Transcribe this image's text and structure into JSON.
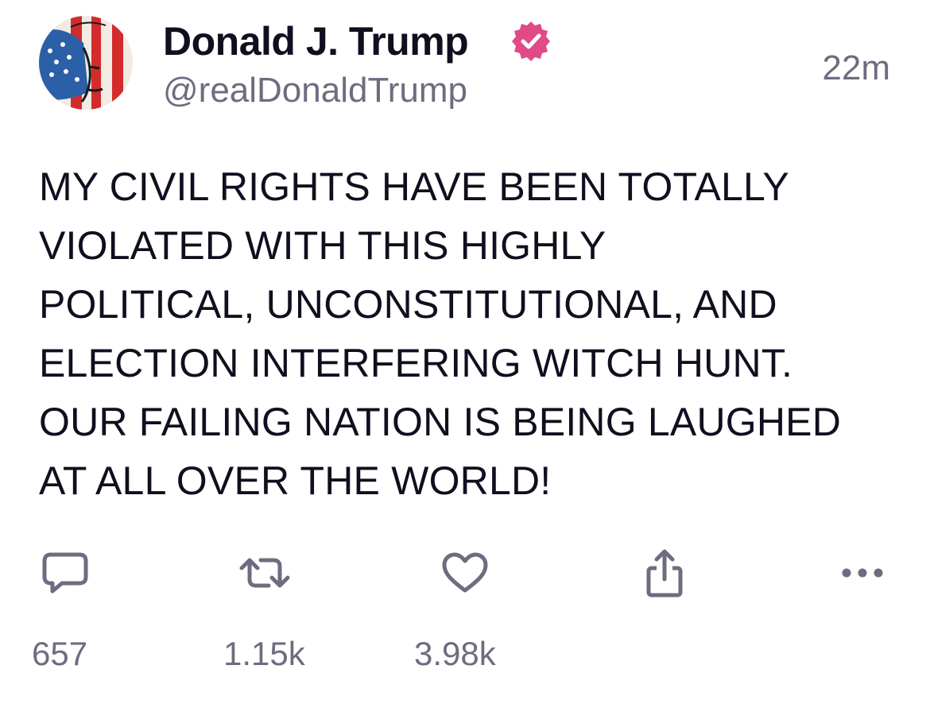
{
  "post": {
    "author": {
      "display_name": "Donald J. Trump",
      "handle": "@realDonaldTrump",
      "verified": true,
      "avatar_icon": "flag-painted-portrait-avatar"
    },
    "timestamp": "22m",
    "body_lines": [
      "MY CIVIL RIGHTS HAVE BEEN TOTALLY",
      "VIOLATED WITH THIS HIGHLY",
      "POLITICAL, UNCONSTITUTIONAL, AND",
      "ELECTION INTERFERING WITCH HUNT.",
      "OUR FAILING NATION IS BEING LAUGHED",
      "AT ALL OVER THE WORLD!"
    ],
    "actions": {
      "reply": {
        "icon": "reply-bubble-icon",
        "count": "657"
      },
      "retruth": {
        "icon": "retruth-arrows-icon",
        "count": "1.15k"
      },
      "like": {
        "icon": "heart-icon",
        "count": "3.98k"
      },
      "share": {
        "icon": "share-icon"
      },
      "more": {
        "icon": "more-dots-icon"
      }
    }
  },
  "colors": {
    "text_primary": "#0f0f1f",
    "text_secondary": "#6e6c80",
    "icon_gray": "#6e6c80",
    "verified_badge": "#e14a86",
    "background": "#ffffff"
  }
}
